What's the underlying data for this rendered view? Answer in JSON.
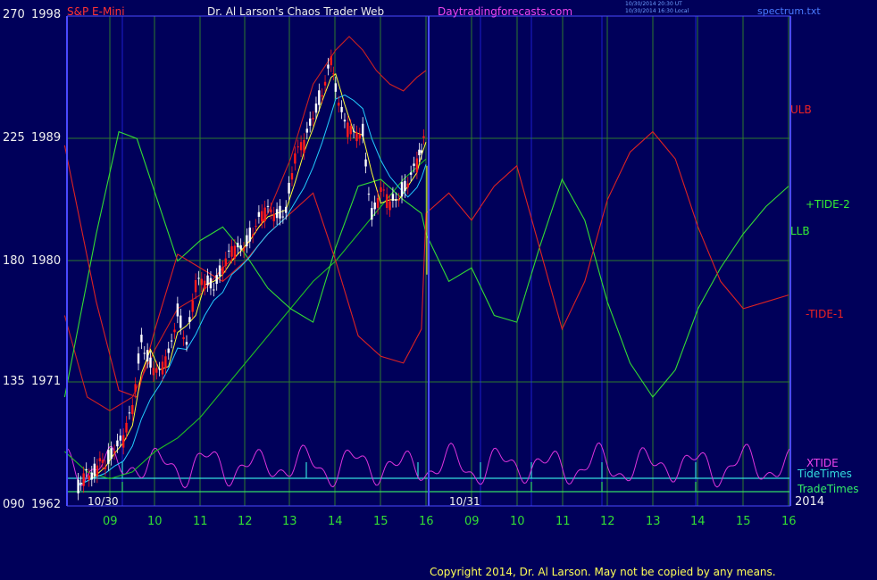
{
  "header": {
    "instrument": "S&P E-Mini",
    "site_title": "Dr. Al Larson's Chaos Trader Web",
    "site_url": "Daytradingforecasts.com",
    "ut_stamp": "10/30/2014 20:30 UT",
    "local_stamp": "10/30/2014 16:30 Local",
    "filename": "spectrum.txt"
  },
  "footer": {
    "copyright": "Copyright 2014, Dr. Al Larson. May not be copied by any means."
  },
  "colors": {
    "background": "#00005a",
    "grid": "#2e7a2e",
    "axis": "#4a4aff",
    "price_up": "#ffffff",
    "price_down": "#ff1a1a",
    "ulb": "#cc2020",
    "llb": "#20c020",
    "tide_pos": "#33dd33",
    "tide_neg": "#dd2222",
    "xtide": "#dd33dd",
    "tide_times": "#33dddd",
    "trade_times": "#33dd66",
    "ma_yellow": "#ffff33",
    "ma_cyan": "#22ccff"
  },
  "chart_data": {
    "type": "line",
    "title": "S&P E-Mini",
    "y_left_labels": [
      {
        "pct": "270",
        "price": "1998"
      },
      {
        "pct": "225",
        "price": "1989"
      },
      {
        "pct": "180",
        "price": "1980"
      },
      {
        "pct": "135",
        "price": "1971"
      },
      {
        "pct": "090",
        "price": "1962"
      }
    ],
    "ylim": [
      1962,
      1998
    ],
    "x_hour_labels": [
      "09",
      "10",
      "11",
      "12",
      "13",
      "14",
      "15",
      "16",
      "09",
      "10",
      "11",
      "12",
      "13",
      "14",
      "15",
      "16"
    ],
    "date_labels": [
      "10/30",
      "10/31"
    ],
    "year_label": "2014",
    "series_labels": {
      "ulb": "ULB",
      "tide_pos": "+TIDE-2",
      "llb": "LLB",
      "tide_neg": "-TIDE-1",
      "xtide": "XTIDE",
      "tide_times": "TideTimes",
      "trade_times": "TradeTimes"
    },
    "series": [
      {
        "key": "price",
        "x": [
          8.3,
          8.6,
          8.9,
          9.1,
          9.3,
          9.5,
          9.7,
          9.9,
          10.1,
          10.3,
          10.5,
          10.7,
          10.9,
          11.1,
          11.3,
          11.5,
          11.7,
          11.9,
          12.1,
          12.3,
          12.5,
          12.7,
          12.9,
          13.1,
          13.3,
          13.5,
          13.7,
          13.9,
          14.0,
          14.2,
          14.4,
          14.6,
          14.8,
          15.0,
          15.2,
          15.4,
          15.6,
          15.8,
          15.9,
          16.0
        ],
        "values": [
          1963.5,
          1964.5,
          1965.2,
          1966.5,
          1966.8,
          1969.0,
          1974.5,
          1972.5,
          1971.5,
          1973.0,
          1976.5,
          1974.0,
          1978.0,
          1978.5,
          1978.5,
          1979.5,
          1980.5,
          1981.0,
          1982.0,
          1983.0,
          1983.5,
          1983.5,
          1984.0,
          1987.5,
          1988.5,
          1991.0,
          1992.5,
          1994.5,
          1993.0,
          1990.0,
          1989.0,
          1989.5,
          1983.5,
          1985.0,
          1984.0,
          1985.0,
          1986.0,
          1987.0,
          1988.5,
          1989.0
        ]
      },
      {
        "key": "ulb",
        "x": [
          8.0,
          8.5,
          9.0,
          9.5,
          10.0,
          10.5,
          11.0,
          11.5,
          12.0,
          12.5,
          13.0,
          13.5,
          14.0,
          14.3,
          14.6,
          14.9,
          15.2,
          15.5,
          15.8,
          16.0
        ],
        "values": [
          1976.0,
          1970.0,
          1969.0,
          1970.0,
          1973.5,
          1976.5,
          1977.5,
          1979.5,
          1981.0,
          1983.5,
          1987.5,
          1993.0,
          1995.5,
          1996.5,
          1995.5,
          1994.0,
          1993.0,
          1992.5,
          1993.5,
          1994.0
        ]
      },
      {
        "key": "llb",
        "x": [
          8.0,
          8.5,
          9.0,
          9.5,
          10.0,
          10.5,
          11.0,
          11.5,
          12.0,
          12.5,
          13.0,
          13.5,
          14.0,
          14.5,
          15.0,
          15.5,
          16.0
        ],
        "values": [
          1966.0,
          1964.5,
          1964.0,
          1964.5,
          1966.0,
          1967.0,
          1968.5,
          1970.5,
          1972.5,
          1974.5,
          1976.5,
          1978.5,
          1980.0,
          1982.0,
          1984.0,
          1986.0,
          1987.5
        ]
      },
      {
        "key": "tide_pos",
        "x": [
          8.0,
          8.7,
          9.2,
          9.6,
          10.0,
          10.5,
          11.0,
          11.5,
          12.0,
          12.5,
          13.0,
          13.5,
          14.0,
          14.5,
          15.0,
          15.5,
          15.9,
          16.0,
          16.5,
          17.0,
          17.5,
          18.0,
          18.5,
          19.0,
          19.5,
          20.0,
          20.5,
          21.0,
          21.5,
          22.0,
          22.5,
          23.0,
          23.5,
          24.0
        ],
        "values": [
          1970.0,
          1982.0,
          1989.5,
          1989.0,
          1985.0,
          1980.0,
          1981.5,
          1982.5,
          1980.5,
          1978.0,
          1976.5,
          1975.5,
          1981.0,
          1985.5,
          1986.0,
          1984.5,
          1983.5,
          1982.0,
          1978.5,
          1979.5,
          1976.0,
          1975.5,
          1981.0,
          1986.0,
          1983.0,
          1977.0,
          1972.5,
          1970.0,
          1972.0,
          1976.5,
          1979.5,
          1982.0,
          1984.0,
          1985.5
        ]
      },
      {
        "key": "tide_neg",
        "x": [
          8.0,
          8.7,
          9.2,
          9.6,
          10.0,
          10.5,
          11.0,
          11.5,
          12.0,
          12.5,
          13.0,
          13.5,
          14.0,
          14.5,
          15.0,
          15.5,
          15.9,
          16.0,
          16.5,
          17.0,
          17.5,
          18.0,
          18.5,
          19.0,
          19.5,
          20.0,
          20.5,
          21.0,
          21.5,
          22.0,
          22.5,
          23.0,
          23.5,
          24.0
        ],
        "values": [
          1988.5,
          1977.0,
          1970.5,
          1970.0,
          1975.0,
          1980.5,
          1979.5,
          1978.5,
          1980.0,
          1982.0,
          1983.5,
          1985.0,
          1980.0,
          1974.5,
          1973.0,
          1972.5,
          1975.0,
          1983.5,
          1985.0,
          1983.0,
          1985.5,
          1987.0,
          1981.0,
          1975.0,
          1978.5,
          1984.5,
          1988.0,
          1989.5,
          1987.5,
          1982.5,
          1978.5,
          1976.5,
          1977.0,
          1977.5
        ]
      }
    ]
  }
}
